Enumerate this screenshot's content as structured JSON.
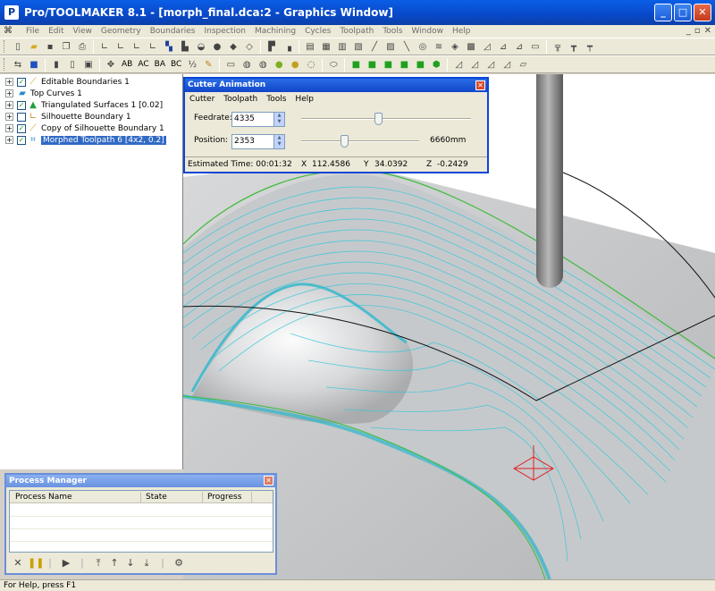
{
  "window": {
    "title": "Pro/TOOLMAKER 8.1 - [morph_final.dca:2 - Graphics Window]",
    "minimize_glyph": "_",
    "maximize_glyph": "□",
    "close_glyph": "✕"
  },
  "menubar": {
    "items": [
      "File",
      "Edit",
      "View",
      "Geometry",
      "Boundaries",
      "Inspection",
      "Machining",
      "Cycles",
      "Toolpath",
      "Tools",
      "Window",
      "Help"
    ]
  },
  "toolbar2": {
    "labels": [
      "AB",
      "AC",
      "BA",
      "BC"
    ]
  },
  "tree": {
    "items": [
      {
        "label": "Editable Boundaries 1",
        "checked": true,
        "icon": "editable-boundary-icon"
      },
      {
        "label": "Top Curves 1",
        "checked": null,
        "icon": "curves-icon"
      },
      {
        "label": "Triangulated Surfaces 1 [0.02]",
        "checked": true,
        "icon": "surface-icon"
      },
      {
        "label": "Silhouette Boundary 1",
        "checked": false,
        "icon": "silhouette-boundary-icon"
      },
      {
        "label": "Copy of Silhouette Boundary 1",
        "checked": true,
        "icon": "editable-boundary-icon"
      },
      {
        "label": "Morphed Toolpath 6 [4x2, 0.2]",
        "checked": true,
        "icon": "toolpath-icon",
        "selected": true
      }
    ]
  },
  "cutter_dialog": {
    "title": "Cutter Animation",
    "menu": [
      "Cutter",
      "Toolpath",
      "Tools",
      "Help"
    ],
    "feedrate_label": "Feedrate:",
    "feedrate_value": "4335",
    "feedrate_slider_fraction": 0.45,
    "position_label": "Position:",
    "position_value": "2353",
    "position_max": "6660mm",
    "position_slider_fraction": 0.36,
    "estimated_time": "Estimated Time: 00:01:32",
    "x_label": "X",
    "x_value": "112.4586",
    "y_label": "Y",
    "y_value": "34.0392",
    "z_label": "Z",
    "z_value": "-0.2429"
  },
  "process_manager": {
    "title": "Process Manager",
    "columns": [
      "Process Name",
      "State",
      "Progress"
    ]
  },
  "statusbar": {
    "text": "For Help, press F1"
  },
  "colors": {
    "toolpath": "#3ec8d8",
    "surface": "#c8cacc",
    "boundary": "#3cbc3c",
    "tool": "#909090"
  }
}
